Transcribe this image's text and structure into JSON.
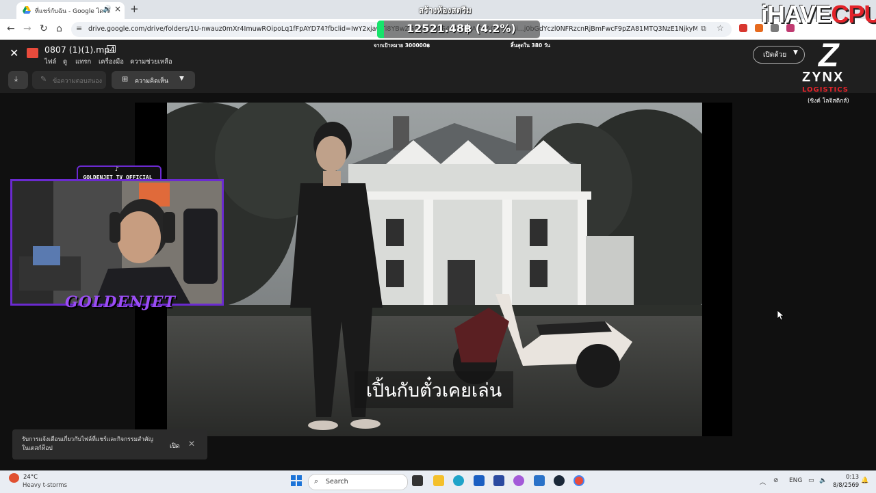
{
  "browser": {
    "tab_title": "ที่แชร์กับฉัน - Google ไดรฟ์",
    "url": "drive.google.com/drive/folders/1U-nwauz0mXr4ImuwROipoLq1fFpAYD74?fbclid=IwY2xjawTi8YBwZG9BGV4dG4DYWVtAjExAGJyaWRi...j0bGdYczl0NFRzcnRjBmFwcF9pZA81MTQ3NzE1NjkyMjgwNjE..."
  },
  "viewer": {
    "file_name": "0807 (1)(1).mp4",
    "menu": [
      "ไฟล์",
      "ดู",
      "แทรก",
      "เครื่องมือ",
      "ความช่วยเหลือ"
    ],
    "open_with_label": "เปิดด้วย",
    "caption_button_label": "ข้อความตอบสนอง",
    "comment_button_label": "ความคิดเห็น",
    "subtitle": "เปิ้นกับตั๋วเคยเล่น"
  },
  "stream_overlay": {
    "title": "สร้างห้องสตรีม",
    "donation_amount": "12521.48฿ (4.2%)",
    "donation_progress_percent": 4.2,
    "goal_label": "จากเป้าหมาย 300000฿",
    "ends_label": "สิ้นสุดใน 380 วัน",
    "webcam_handle": "GOLDENJET_TV_OFFICIAL",
    "webcam_name": "GOLDENJET",
    "sponsor_1": {
      "part1": "iHAVE",
      "part2": "CPU"
    },
    "sponsor_2": {
      "mark": "Z",
      "name": "ZYNX",
      "sub": "LOGISTICS",
      "thai": "(ซิงค์ โลจิสติกส์)"
    }
  },
  "toast": {
    "text": "รับการแจ้งเตือนเกี่ยวกับไฟล์ที่แชร์และกิจกรรมสำคัญในเดสก์ท็อป",
    "open_label": "เปิด"
  },
  "taskbar": {
    "temperature": "24°C",
    "weather": "Heavy t-storms",
    "search_placeholder": "Search",
    "lang": "ENG",
    "time": "0:13",
    "date": "8/8/2569"
  },
  "colors": {
    "accent_purple": "#6b2ad0",
    "progress_green": "#16e36b",
    "brand_red": "#e3232a"
  }
}
